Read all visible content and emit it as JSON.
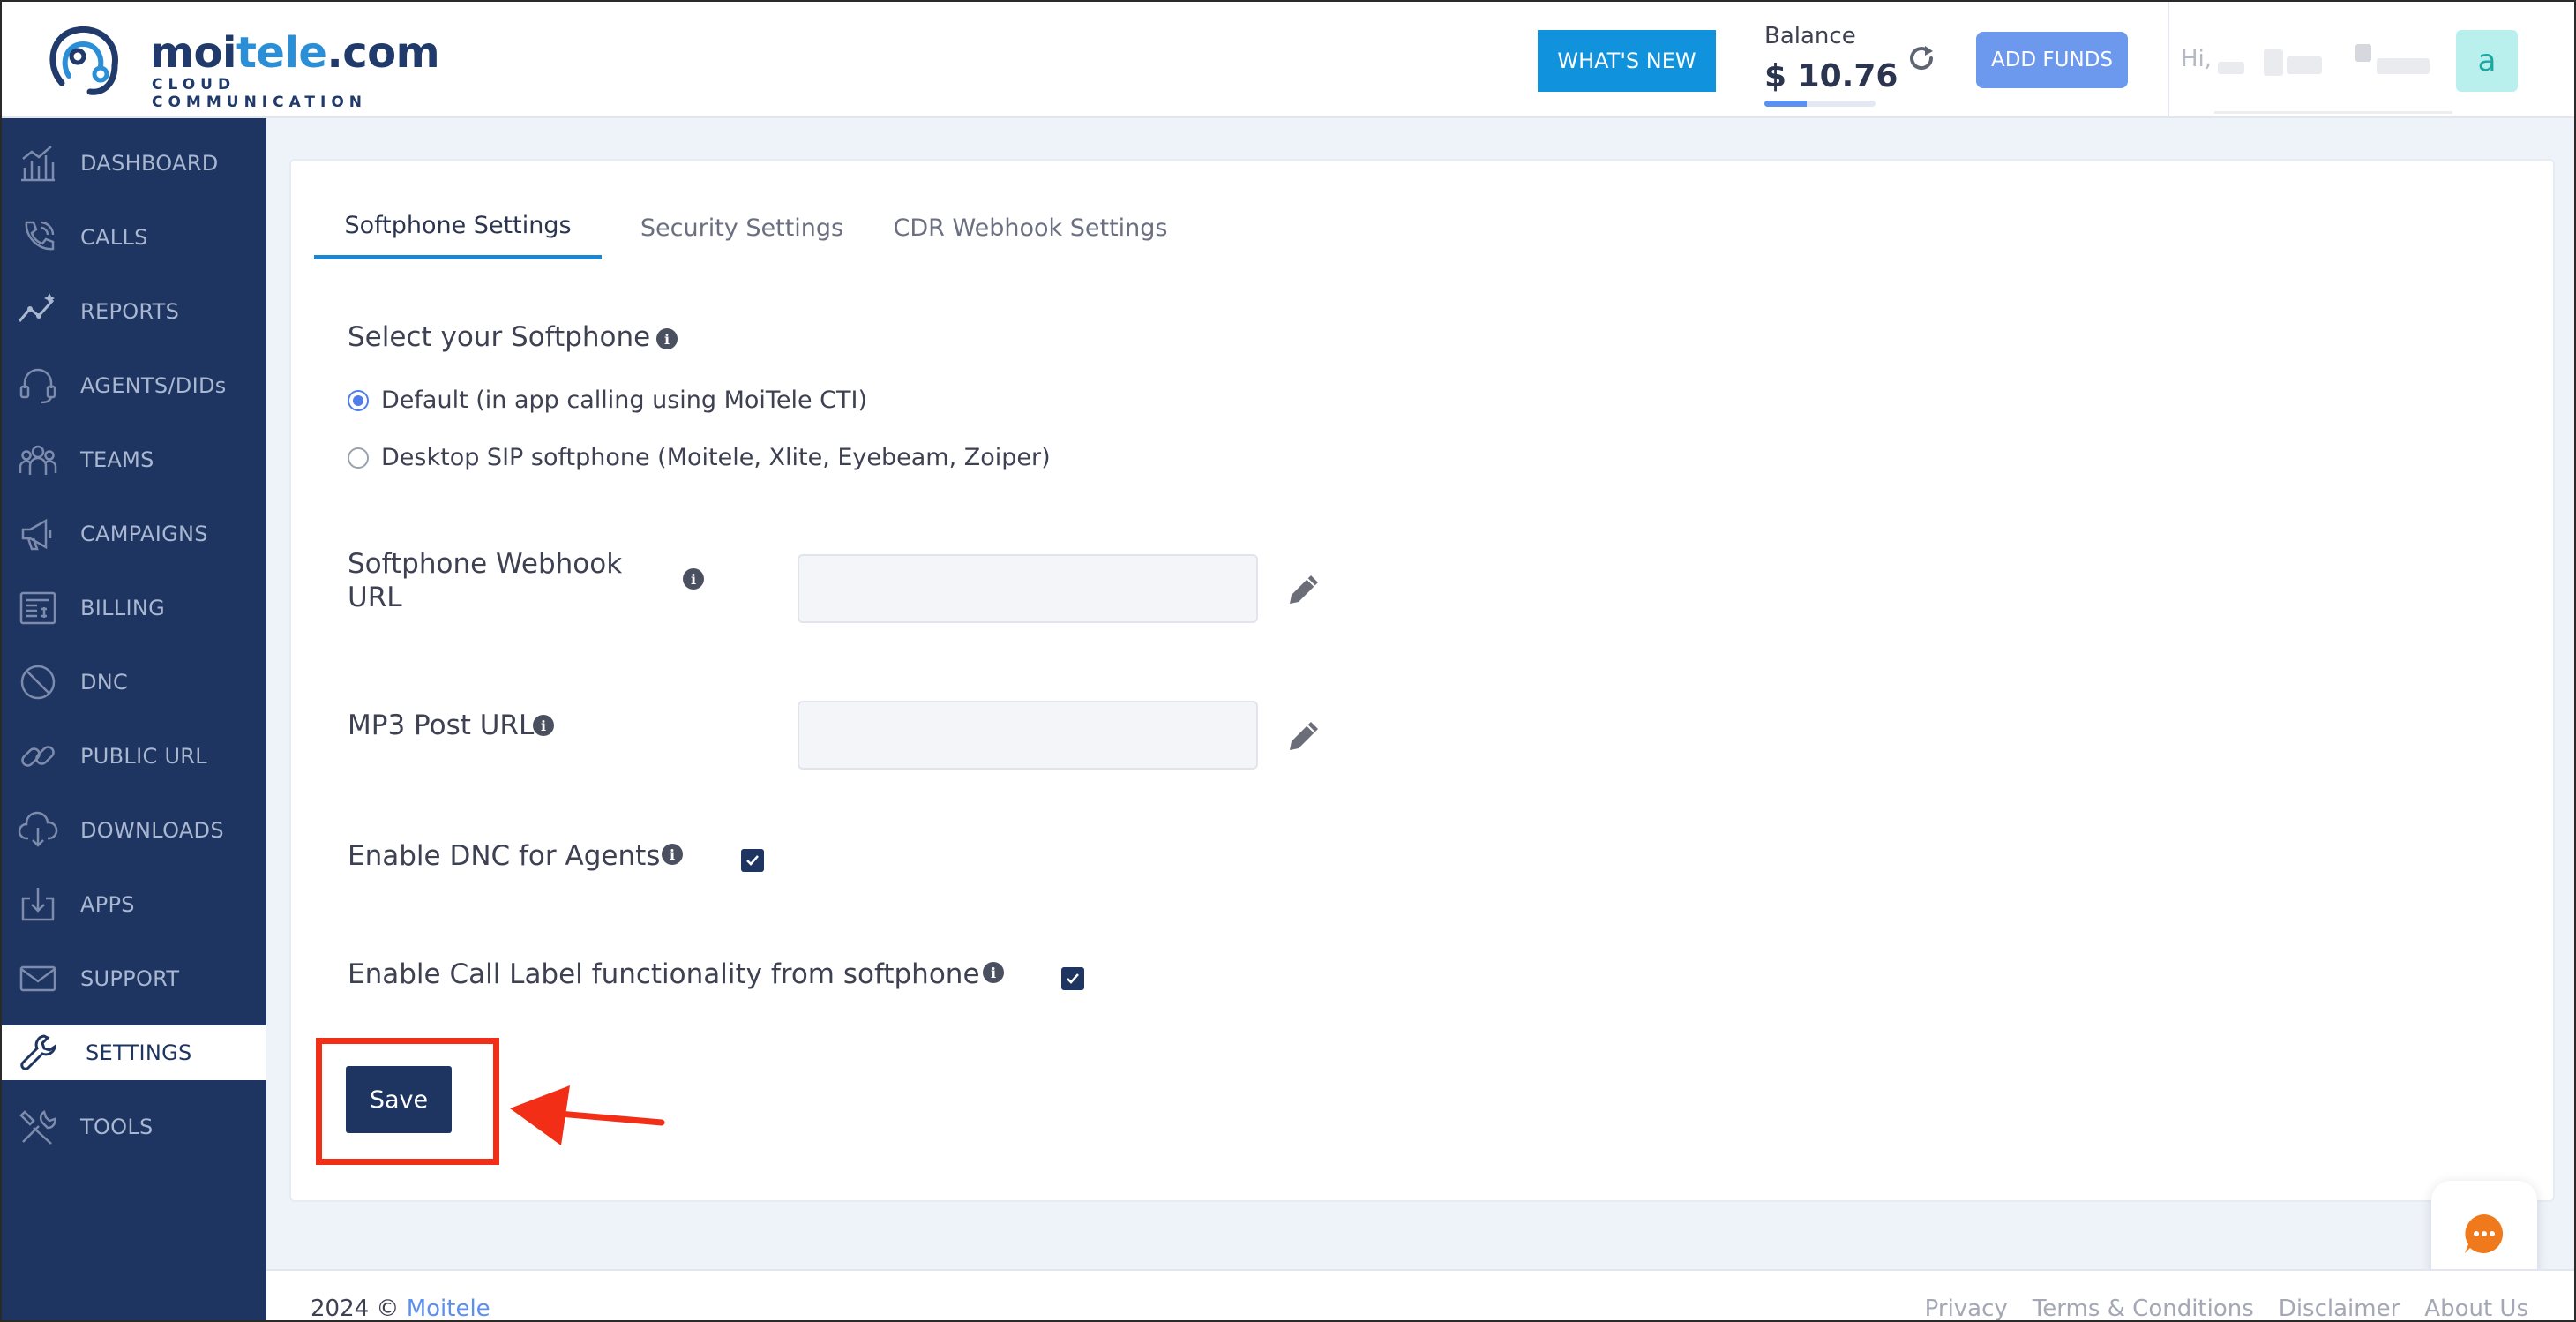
{
  "header": {
    "logo_text_a": "moi",
    "logo_text_b": "tele",
    "logo_text_c": ".com",
    "logo_subtitle": "CLOUD COMMUNICATION",
    "whats_new_label": "WHAT'S NEW",
    "balance_label": "Balance",
    "balance_value": "$ 10.76",
    "balance_bar_level": 0.38,
    "add_funds_label": "ADD FUNDS",
    "greeting": "Hi,",
    "avatar_letter": "a"
  },
  "sidebar": {
    "items": [
      {
        "label": "DASHBOARD",
        "icon": "dashboard-icon"
      },
      {
        "label": "CALLS",
        "icon": "phone-icon"
      },
      {
        "label": "REPORTS",
        "icon": "reports-icon"
      },
      {
        "label": "AGENTS/DIDs",
        "icon": "headset-icon"
      },
      {
        "label": "TEAMS",
        "icon": "teams-icon"
      },
      {
        "label": "CAMPAIGNS",
        "icon": "megaphone-icon"
      },
      {
        "label": "BILLING",
        "icon": "invoice-icon"
      },
      {
        "label": "DNC",
        "icon": "block-icon"
      },
      {
        "label": "PUBLIC URL",
        "icon": "link-icon"
      },
      {
        "label": "DOWNLOADS",
        "icon": "cloud-download-icon"
      },
      {
        "label": "APPS",
        "icon": "apps-download-icon"
      },
      {
        "label": "SUPPORT",
        "icon": "mail-icon"
      },
      {
        "label": "SETTINGS",
        "icon": "wrench-icon"
      },
      {
        "label": "TOOLS",
        "icon": "tools-icon"
      }
    ],
    "active": "SETTINGS"
  },
  "tabs": [
    {
      "label": "Softphone Settings",
      "active": true
    },
    {
      "label": "Security Settings",
      "active": false
    },
    {
      "label": "CDR Webhook Settings",
      "active": false
    }
  ],
  "form": {
    "softphone_title": "Select your Softphone",
    "option_default": "Default (in app calling using MoiTele CTI)",
    "option_desktop": "Desktop SIP softphone (Moitele, Xlite, Eyebeam, Zoiper)",
    "selected_option": "default",
    "webhook_label_line1": "Softphone Webhook",
    "webhook_label_line2": "URL",
    "webhook_value": "",
    "mp3_label": "MP3 Post URL",
    "mp3_value": "",
    "dnc_label": "Enable DNC for Agents",
    "dnc_checked": true,
    "call_label_label": "Enable Call Label functionality from softphone",
    "call_label_checked": true,
    "save_label": "Save"
  },
  "footer": {
    "copyright": "2024 ©",
    "brand": "Moitele",
    "links": [
      "Privacy",
      "Terms & Conditions",
      "Disclaimer",
      "About Us"
    ]
  },
  "colors": {
    "sidebar_bg": "#1e3561",
    "accent_blue": "#1092dd",
    "add_funds": "#6c98ee",
    "highlight_red": "#f22e17"
  }
}
